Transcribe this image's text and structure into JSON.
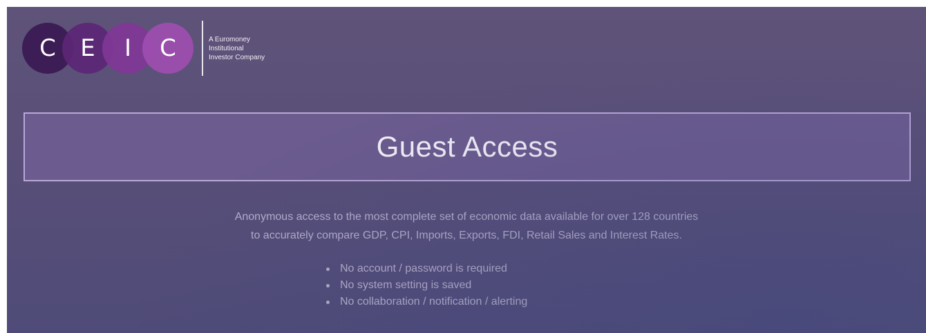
{
  "logo": {
    "letters": [
      "C",
      "E",
      "I",
      "C"
    ],
    "tagline_lines": [
      "A Euromoney",
      "Institutional",
      "Investor Company"
    ]
  },
  "header": {
    "title": "Guest Access"
  },
  "description": {
    "line1": "Anonymous access to the most complete set of economic data available for over 128 countries",
    "line2": "to accurately compare GDP, CPI, Imports, Exports, FDI, Retail Sales and Interest Rates."
  },
  "features": [
    "No account / password is required",
    "No system setting is saved",
    "No collaboration / notification / alerting"
  ],
  "colors": {
    "background": "#5b5078",
    "title_box": "#6b5b8e",
    "logo_dark": "#3d1d55",
    "logo_light": "#9e4eb0",
    "text_muted": "#b8b0cc"
  }
}
